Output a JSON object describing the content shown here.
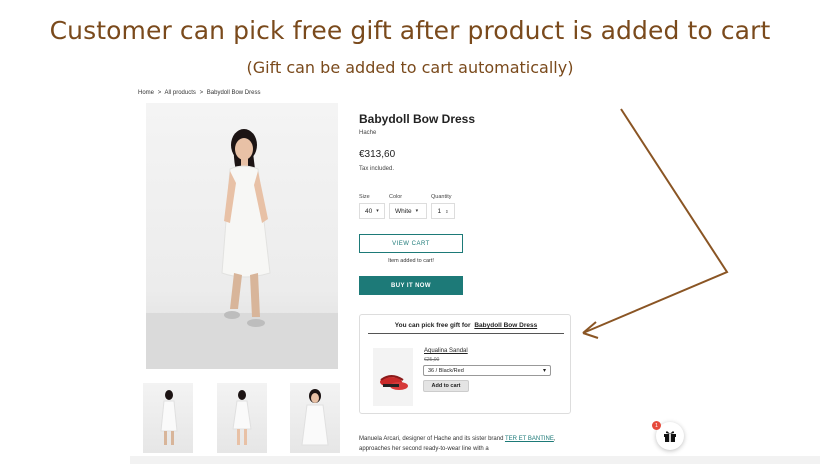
{
  "headline": "Customer can pick free gift after product is added to cart",
  "subline": "(Gift can be added to cart automatically)",
  "breadcrumb": {
    "home": "Home",
    "sep": ">",
    "all": "All products",
    "current": "Babydoll Bow Dress"
  },
  "product": {
    "title": "Babydoll Bow Dress",
    "vendor": "Hache",
    "price": "€313,60",
    "tax_note": "Tax included."
  },
  "options": {
    "size_label": "Size",
    "size_value": "40",
    "color_label": "Color",
    "color_value": "White",
    "qty_label": "Quantity",
    "qty_value": "1"
  },
  "buttons": {
    "view_cart": "VIEW CART",
    "added_msg": "Item added to cart!",
    "buy_now": "BUY IT NOW"
  },
  "gift": {
    "heading": "You can pick free gift for",
    "heading_product": "Babydoll Bow Dress",
    "item_name": "Aqualina Sandal",
    "old_price": "€25,00",
    "variant": "36 / Black/Red",
    "add_label": "Add to cart"
  },
  "description": {
    "text_1": "Manuela Arcari, designer of Hache and its sister brand ",
    "link": "TER ET BANTINE",
    "text_2": ", approaches her second ready-to-wear line with a"
  },
  "gift_widget": {
    "badge_count": "1"
  },
  "colors": {
    "accent": "#1d7a78",
    "headline": "#7a4a1c",
    "arrow": "#8a5524",
    "badge": "#e64b3c"
  },
  "icons": {
    "gift_widget": "gift-icon",
    "select_caret": "caret-down-icon"
  }
}
